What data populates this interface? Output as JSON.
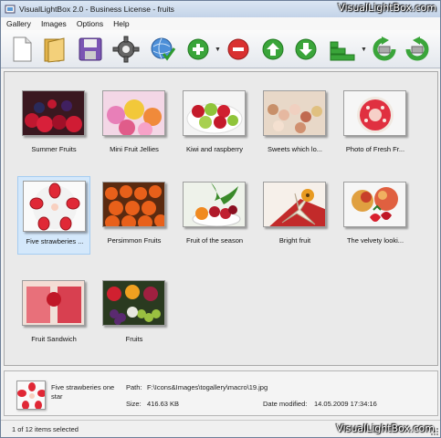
{
  "titlebar": {
    "title": "VisualLightBox 2.0 - Business License - fruits"
  },
  "watermark": {
    "top": "VisualLightBox.com",
    "bottom": "VisualLightBox.com"
  },
  "menu": [
    "Gallery",
    "Images",
    "Options",
    "Help"
  ],
  "toolbar": {
    "buttons": [
      "new-document-icon",
      "open-folder-icon",
      "save-floppy-icon",
      "settings-gear-icon",
      "publish-globe-icon",
      "add-plus-icon",
      "remove-minus-icon",
      "move-up-icon",
      "move-down-icon",
      "templates-stairs-icon",
      "rotate-left-icon",
      "rotate-right-icon"
    ]
  },
  "gallery": {
    "items": [
      {
        "caption": "Summer Fruits",
        "selected": false
      },
      {
        "caption": "Mini Fruit Jellies",
        "selected": false
      },
      {
        "caption": "Kiwi and raspberry",
        "selected": false
      },
      {
        "caption": "Sweets which lo...",
        "selected": false
      },
      {
        "caption": "Photo of Fresh Fr...",
        "selected": false
      },
      {
        "caption": "Five strawberies ...",
        "selected": true
      },
      {
        "caption": "Persimmon Fruits",
        "selected": false
      },
      {
        "caption": "Fruit of the season",
        "selected": false
      },
      {
        "caption": "Bright fruit",
        "selected": false
      },
      {
        "caption": "The velvety looki...",
        "selected": false
      },
      {
        "caption": "Fruit Sandwich",
        "selected": false
      },
      {
        "caption": "Fruits",
        "selected": false
      }
    ]
  },
  "info": {
    "name": "Five strawberies one star",
    "path_label": "Path:",
    "path": "F:\\Icons&Images\\togallery\\macro\\19.jpg",
    "size_label": "Size:",
    "size": "416.63 KB",
    "date_label": "Date modified:",
    "date": "14.05.2009 17:34:16"
  },
  "status": {
    "text": "1 of 12 items selected"
  },
  "colors": {
    "accent_green": "#3aa53a",
    "remove_red": "#d93030",
    "selection": "#d4e8fb"
  }
}
